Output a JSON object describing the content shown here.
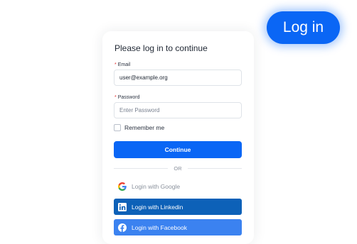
{
  "header": {
    "login_button_label": "Log in"
  },
  "login_form": {
    "title": "Please log in to continue",
    "email": {
      "label": "Email",
      "required_marker": "*",
      "value": "user@example.org",
      "placeholder": ""
    },
    "password": {
      "label": "Password",
      "required_marker": "*",
      "value": "",
      "placeholder": "Enter Password"
    },
    "remember_me": {
      "label": "Remember me",
      "checked": false
    },
    "continue_label": "Continue",
    "divider_text": "OR",
    "social": {
      "google_label": "Login with Google",
      "linkedin_label": "Login with Linkedin",
      "facebook_label": "Login with Facebook"
    }
  },
  "icons": {
    "google": "google-icon",
    "linkedin": "linkedin-icon",
    "facebook": "facebook-icon"
  },
  "colors": {
    "primary": "#0a66f5",
    "linkedin": "#0d61b8",
    "facebook": "#3b82f0",
    "required": "#e03131"
  }
}
